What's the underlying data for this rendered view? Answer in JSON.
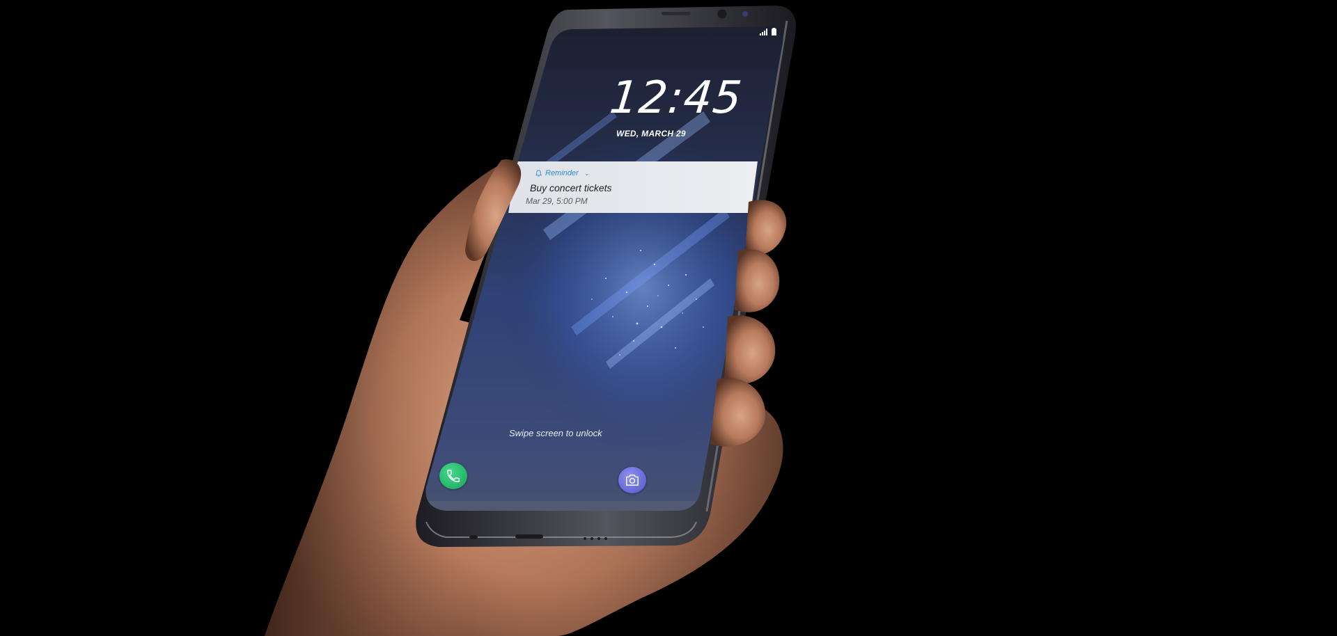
{
  "lockscreen": {
    "time": "12:45",
    "date": "WED, MARCH 29",
    "swipe_hint": "Swipe screen to unlock"
  },
  "notification": {
    "app_name": "Reminder",
    "title": "Buy concert tickets",
    "time": "Mar 29, 5:00 PM"
  },
  "shortcuts": {
    "left": "phone-icon",
    "right": "camera-icon"
  },
  "colors": {
    "background": "#000000",
    "accent": "#2a8fd0",
    "phone_shortcut": "#1fb866",
    "camera_shortcut": "#6466d8"
  }
}
